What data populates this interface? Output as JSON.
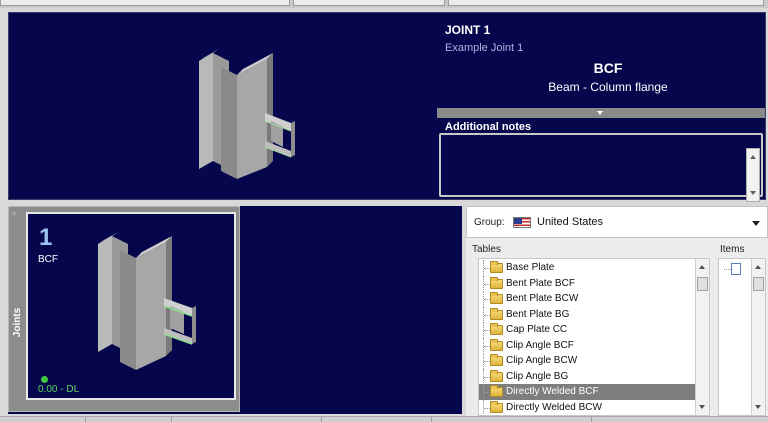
{
  "joint": {
    "title": "JOINT 1",
    "subtitle": "Example Joint 1",
    "code": "BCF",
    "description": "Beam - Column flange"
  },
  "notes": {
    "label": "Additional notes",
    "value": ""
  },
  "joints_panel": {
    "tab_label": "Joints",
    "thumbnail": {
      "number": "1",
      "code": "BCF",
      "status": "0.00 - DL",
      "status_color": "#3ec63e"
    }
  },
  "library": {
    "group_label": "Group:",
    "group_value": "United States",
    "group_icon": "us-flag-icon",
    "tables_label": "Tables",
    "items_label": "Items",
    "tables": [
      "Base Plate",
      "Bent Plate BCF",
      "Bent Plate BCW",
      "Bent Plate BG",
      "Cap Plate CC",
      "Clip Angle BCF",
      "Clip Angle BCW",
      "Clip Angle BG",
      "Directly Welded BCF",
      "Directly Welded BCW"
    ],
    "selected_table": "Directly Welded BCF",
    "table_icon": "folder-icon",
    "item_icon": "document-icon"
  },
  "colors": {
    "panel_bg": "#06064d",
    "selection": "#7e7e7e",
    "thumb_number": "#9cc3ee"
  }
}
